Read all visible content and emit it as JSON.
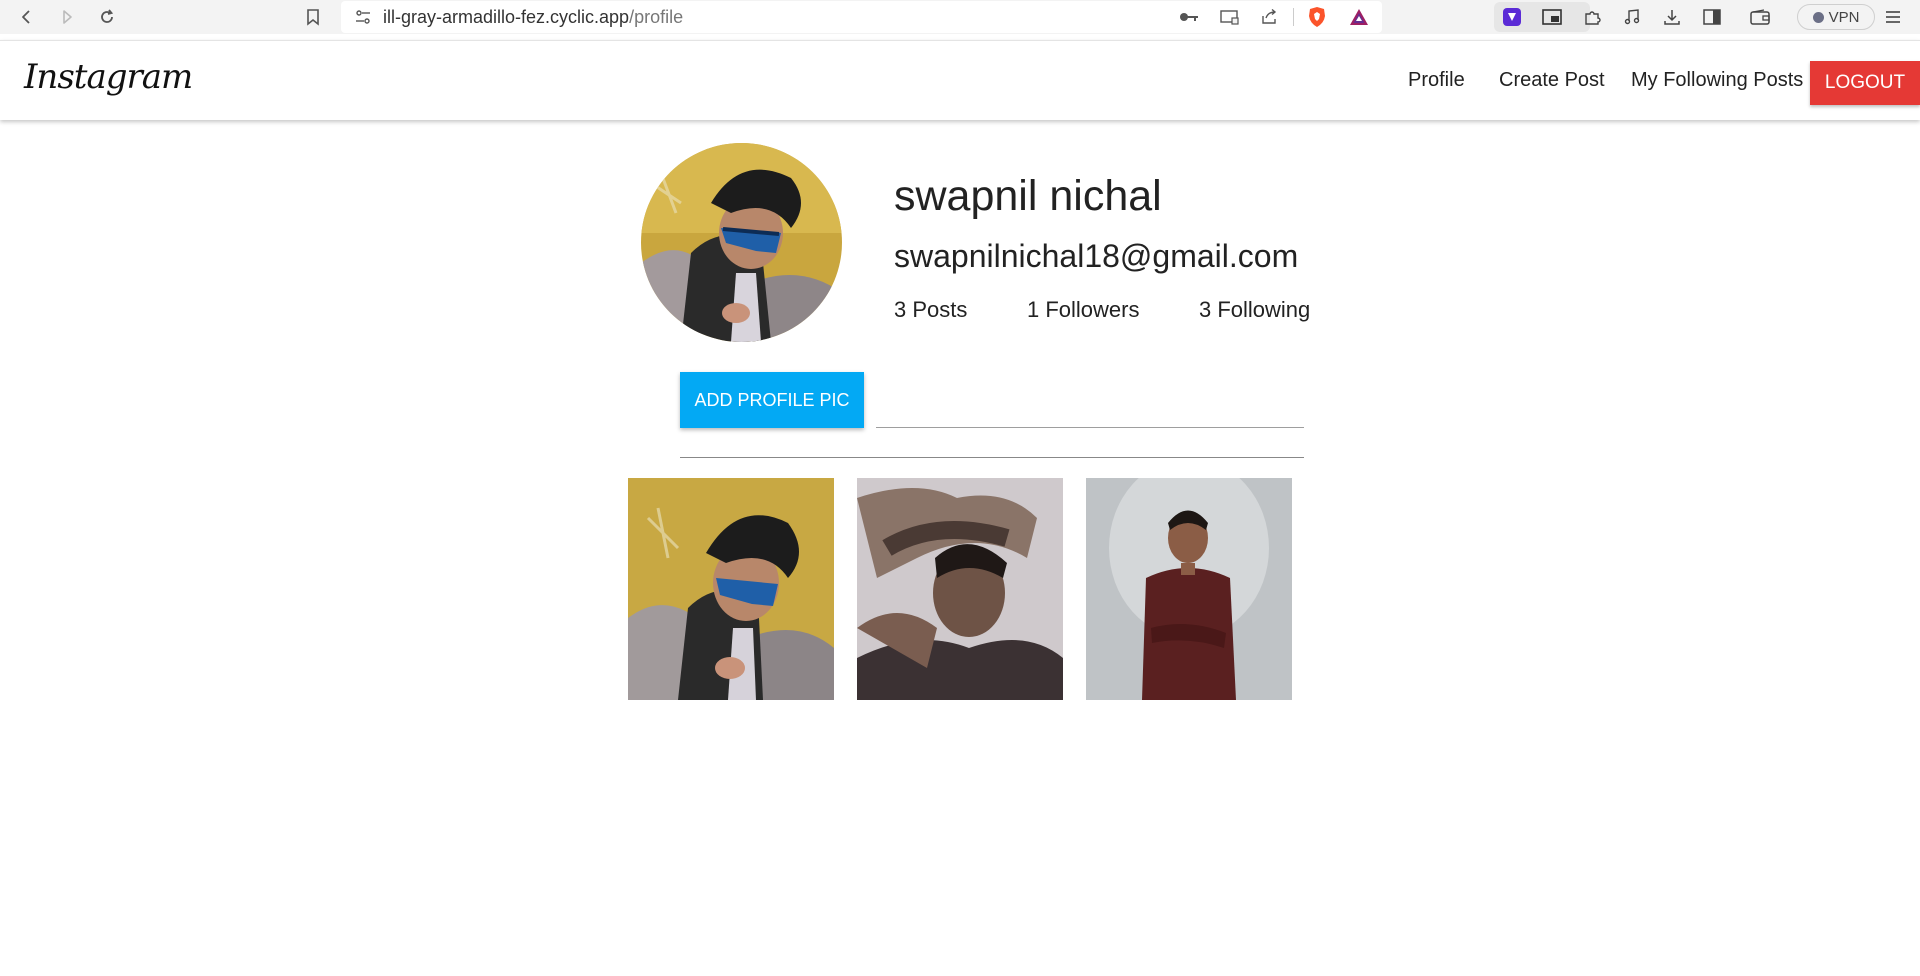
{
  "browser": {
    "url_host": "ill-gray-armadillo-fez.cyclic.app",
    "url_path": "/profile",
    "vpn_label": "VPN"
  },
  "navbar": {
    "brand": "Instagram",
    "links": [
      "Profile",
      "Create Post",
      "My Following Posts"
    ],
    "logout_label": "LOGOUT"
  },
  "profile": {
    "name": "swapnil nichal",
    "email": "swapnilnichal18@gmail.com",
    "posts": "3 Posts",
    "followers": "1 Followers",
    "following": "3 Following",
    "add_pic_label": "ADD PROFILE PIC",
    "file_path_value": ""
  },
  "colors": {
    "logout": "#e53935",
    "add_pic": "#03a9f4"
  },
  "gallery_count": 3
}
